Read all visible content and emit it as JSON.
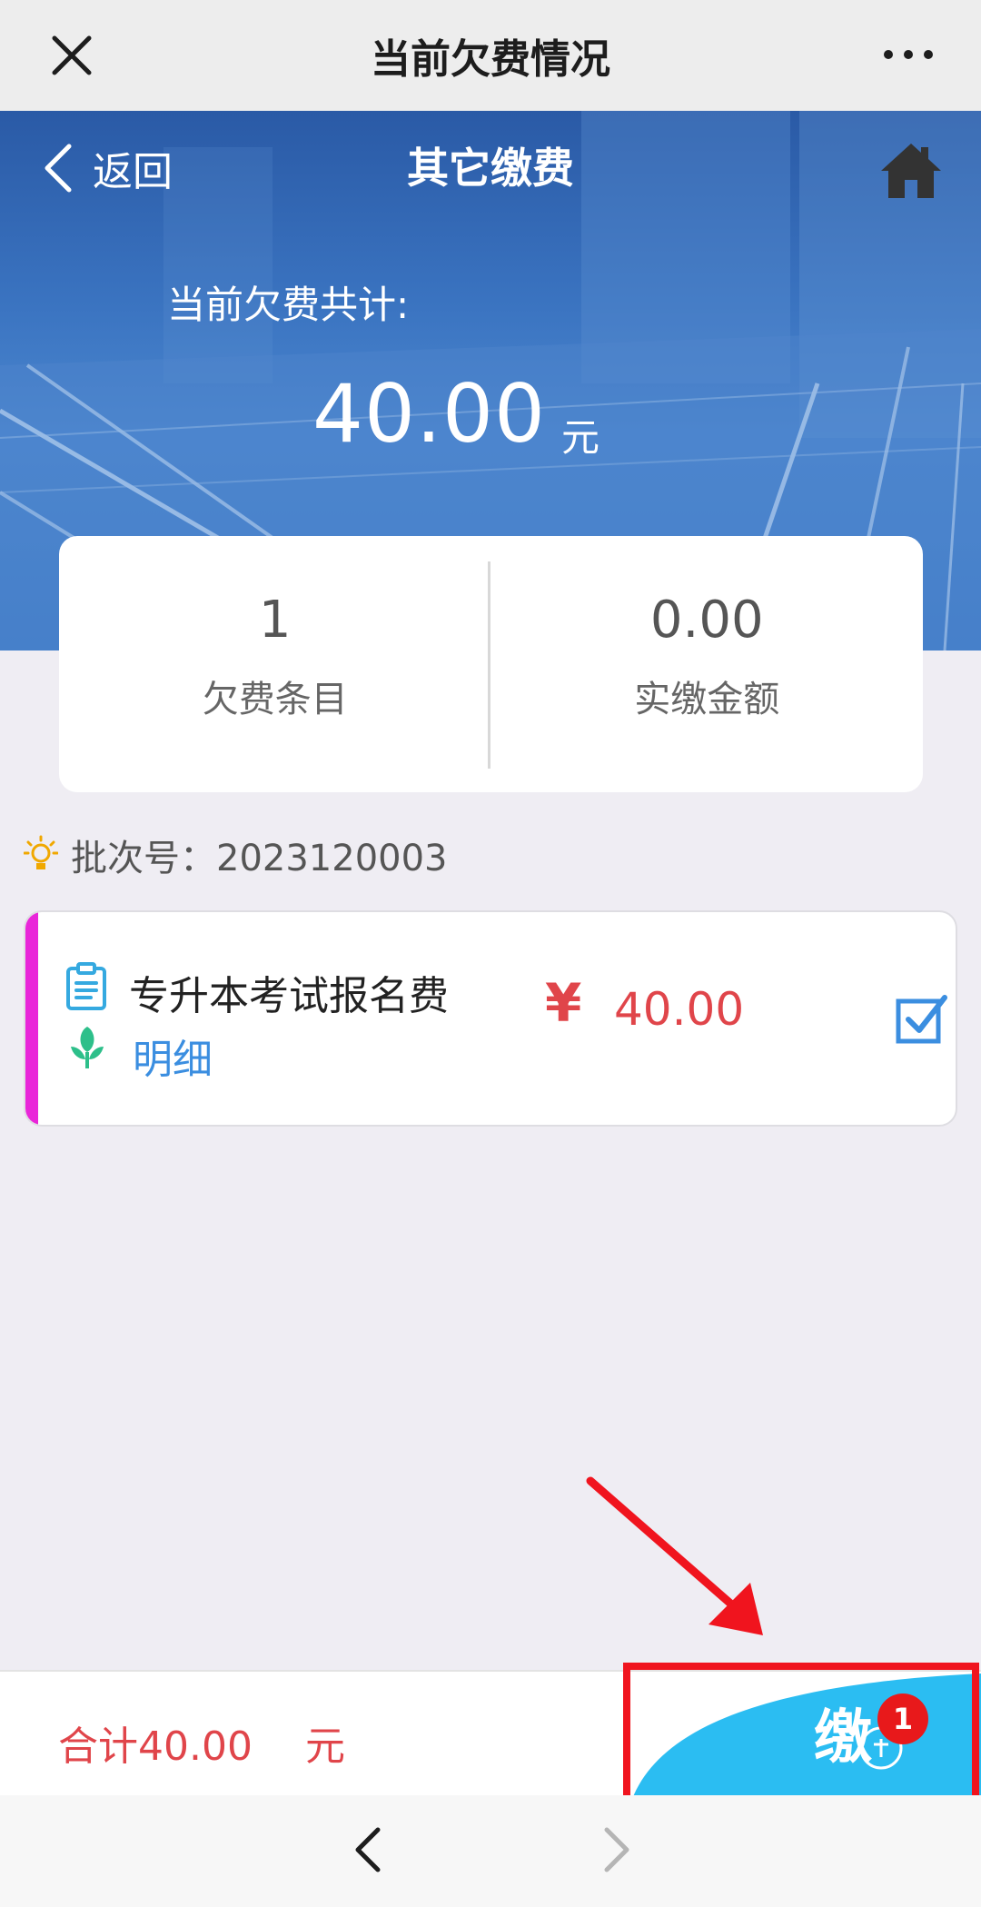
{
  "window": {
    "title": "当前欠费情况"
  },
  "nav": {
    "back_label": "返回",
    "title": "其它缴费"
  },
  "summary": {
    "label": "当前欠费共计:",
    "amount": "40.00",
    "unit": "元"
  },
  "stats": {
    "items": [
      {
        "value": "1",
        "label": "欠费条目"
      },
      {
        "value": "0.00",
        "label": "实缴金额"
      }
    ]
  },
  "batch": {
    "text": "批次号：2023120003"
  },
  "fees": [
    {
      "name": "专升本考试报名费",
      "detail_label": "明细",
      "currency": "¥",
      "amount": "40.00",
      "checked": true
    }
  ],
  "footer": {
    "sum_text": "合计40.00",
    "sum_unit": "元",
    "pay_badge_count": "1"
  },
  "colors": {
    "accent_red": "#e0454a",
    "link_blue": "#3b8ee0",
    "stripe_magenta": "#e926d9",
    "pay_button": "#2bbdf2"
  }
}
